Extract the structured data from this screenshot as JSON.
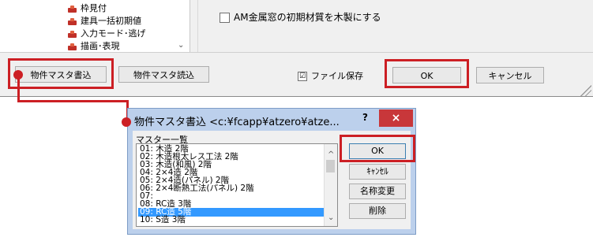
{
  "top_window": {
    "tree_items": [
      "枠見付",
      "建具一括初期値",
      "入力モード･逃げ",
      "描画･表現"
    ],
    "setting_checkbox_label": "AM金属窓の初期材質を木製にする",
    "write_button": "物件マスタ書込",
    "read_button": "物件マスタ読込",
    "file_save_label": "ファイル保存",
    "file_save_checked": "☑",
    "ok_button": "OK",
    "cancel_button": "キャンセル"
  },
  "dialog": {
    "title": "物件マスタ書込 <c:¥fcapp¥atzero¥atze...",
    "help": "?",
    "close": "×",
    "list_label": "マスター一覧",
    "list_items": [
      "01: 木造 2階",
      "02: 木造根太レス工法 2階",
      "03: 木造(和風) 2階",
      "04: 2×4造 2階",
      "05: 2×4造(パネル) 2階",
      "06: 2×4断熱工法(パネル) 2階",
      "07:",
      "08: RC造 3階",
      "09: RC造 5階",
      "10: S造 3階"
    ],
    "selected_index": 8,
    "ok_button": "OK",
    "cancel_button": "ｷｬﾝｾﾙ",
    "rename_button": "名称変更",
    "delete_button": "削除"
  },
  "colors": {
    "highlight": "#cc1f24",
    "selection": "#3399ff",
    "dialog_frame": "#bcd0ec"
  }
}
